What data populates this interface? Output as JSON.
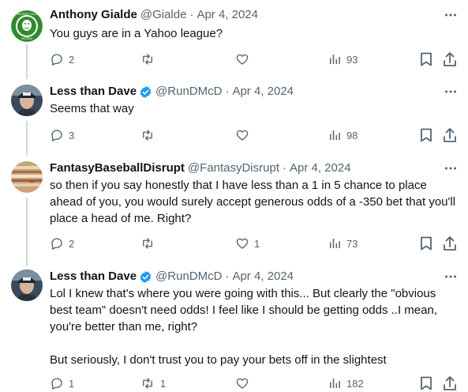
{
  "tweets": [
    {
      "name": "Anthony Gialde",
      "handle": "@Gialde",
      "date": "Apr 4, 2024",
      "verified": false,
      "avatar_icon": "fantasy-club-logo-icon",
      "avatar_text": "FANTASY CLUB",
      "avatar_subtext": "HOOKS",
      "text": [
        "You guys are in a Yahoo league?"
      ],
      "replies": "2",
      "retweets": "",
      "likes": "",
      "views": "93"
    },
    {
      "name": "Less than Dave",
      "handle": "@RunDMcD",
      "date": "Apr 4, 2024",
      "verified": true,
      "avatar_icon": "man-with-cap-photo",
      "text": [
        "Seems that way"
      ],
      "replies": "3",
      "retweets": "",
      "likes": "",
      "views": "98"
    },
    {
      "name": "FantasyBaseballDisrupt",
      "handle": "@FantasyDisrupt",
      "date": "Apr 4, 2024",
      "verified": false,
      "avatar_icon": "jupiter-planet-photo",
      "text": [
        "so then if you say honestly that I have less than a 1 in 5 chance to place ahead of you, you would surely accept generous odds of a -350 bet that you'll place a head of me. Right?"
      ],
      "replies": "2",
      "retweets": "",
      "likes": "1",
      "views": "73"
    },
    {
      "name": "Less than Dave",
      "handle": "@RunDMcD",
      "date": "Apr 4, 2024",
      "verified": true,
      "avatar_icon": "man-with-cap-photo",
      "text": [
        "Lol I knew that's where you were going with this... But clearly the \"obvious best team\" doesn't need odds! I feel like I should be getting odds ..I mean, you're better than me, right?",
        "But seriously, I don't trust you to pay your bets off in the slightest"
      ],
      "replies": "1",
      "retweets": "1",
      "likes": "",
      "views": "182"
    }
  ],
  "colors": {
    "text": "#0f1419",
    "muted": "#536471",
    "verified": "#1d9bf0",
    "thread": "#cfd9de",
    "logo_green": "#2e8b2e"
  },
  "separator": "·"
}
